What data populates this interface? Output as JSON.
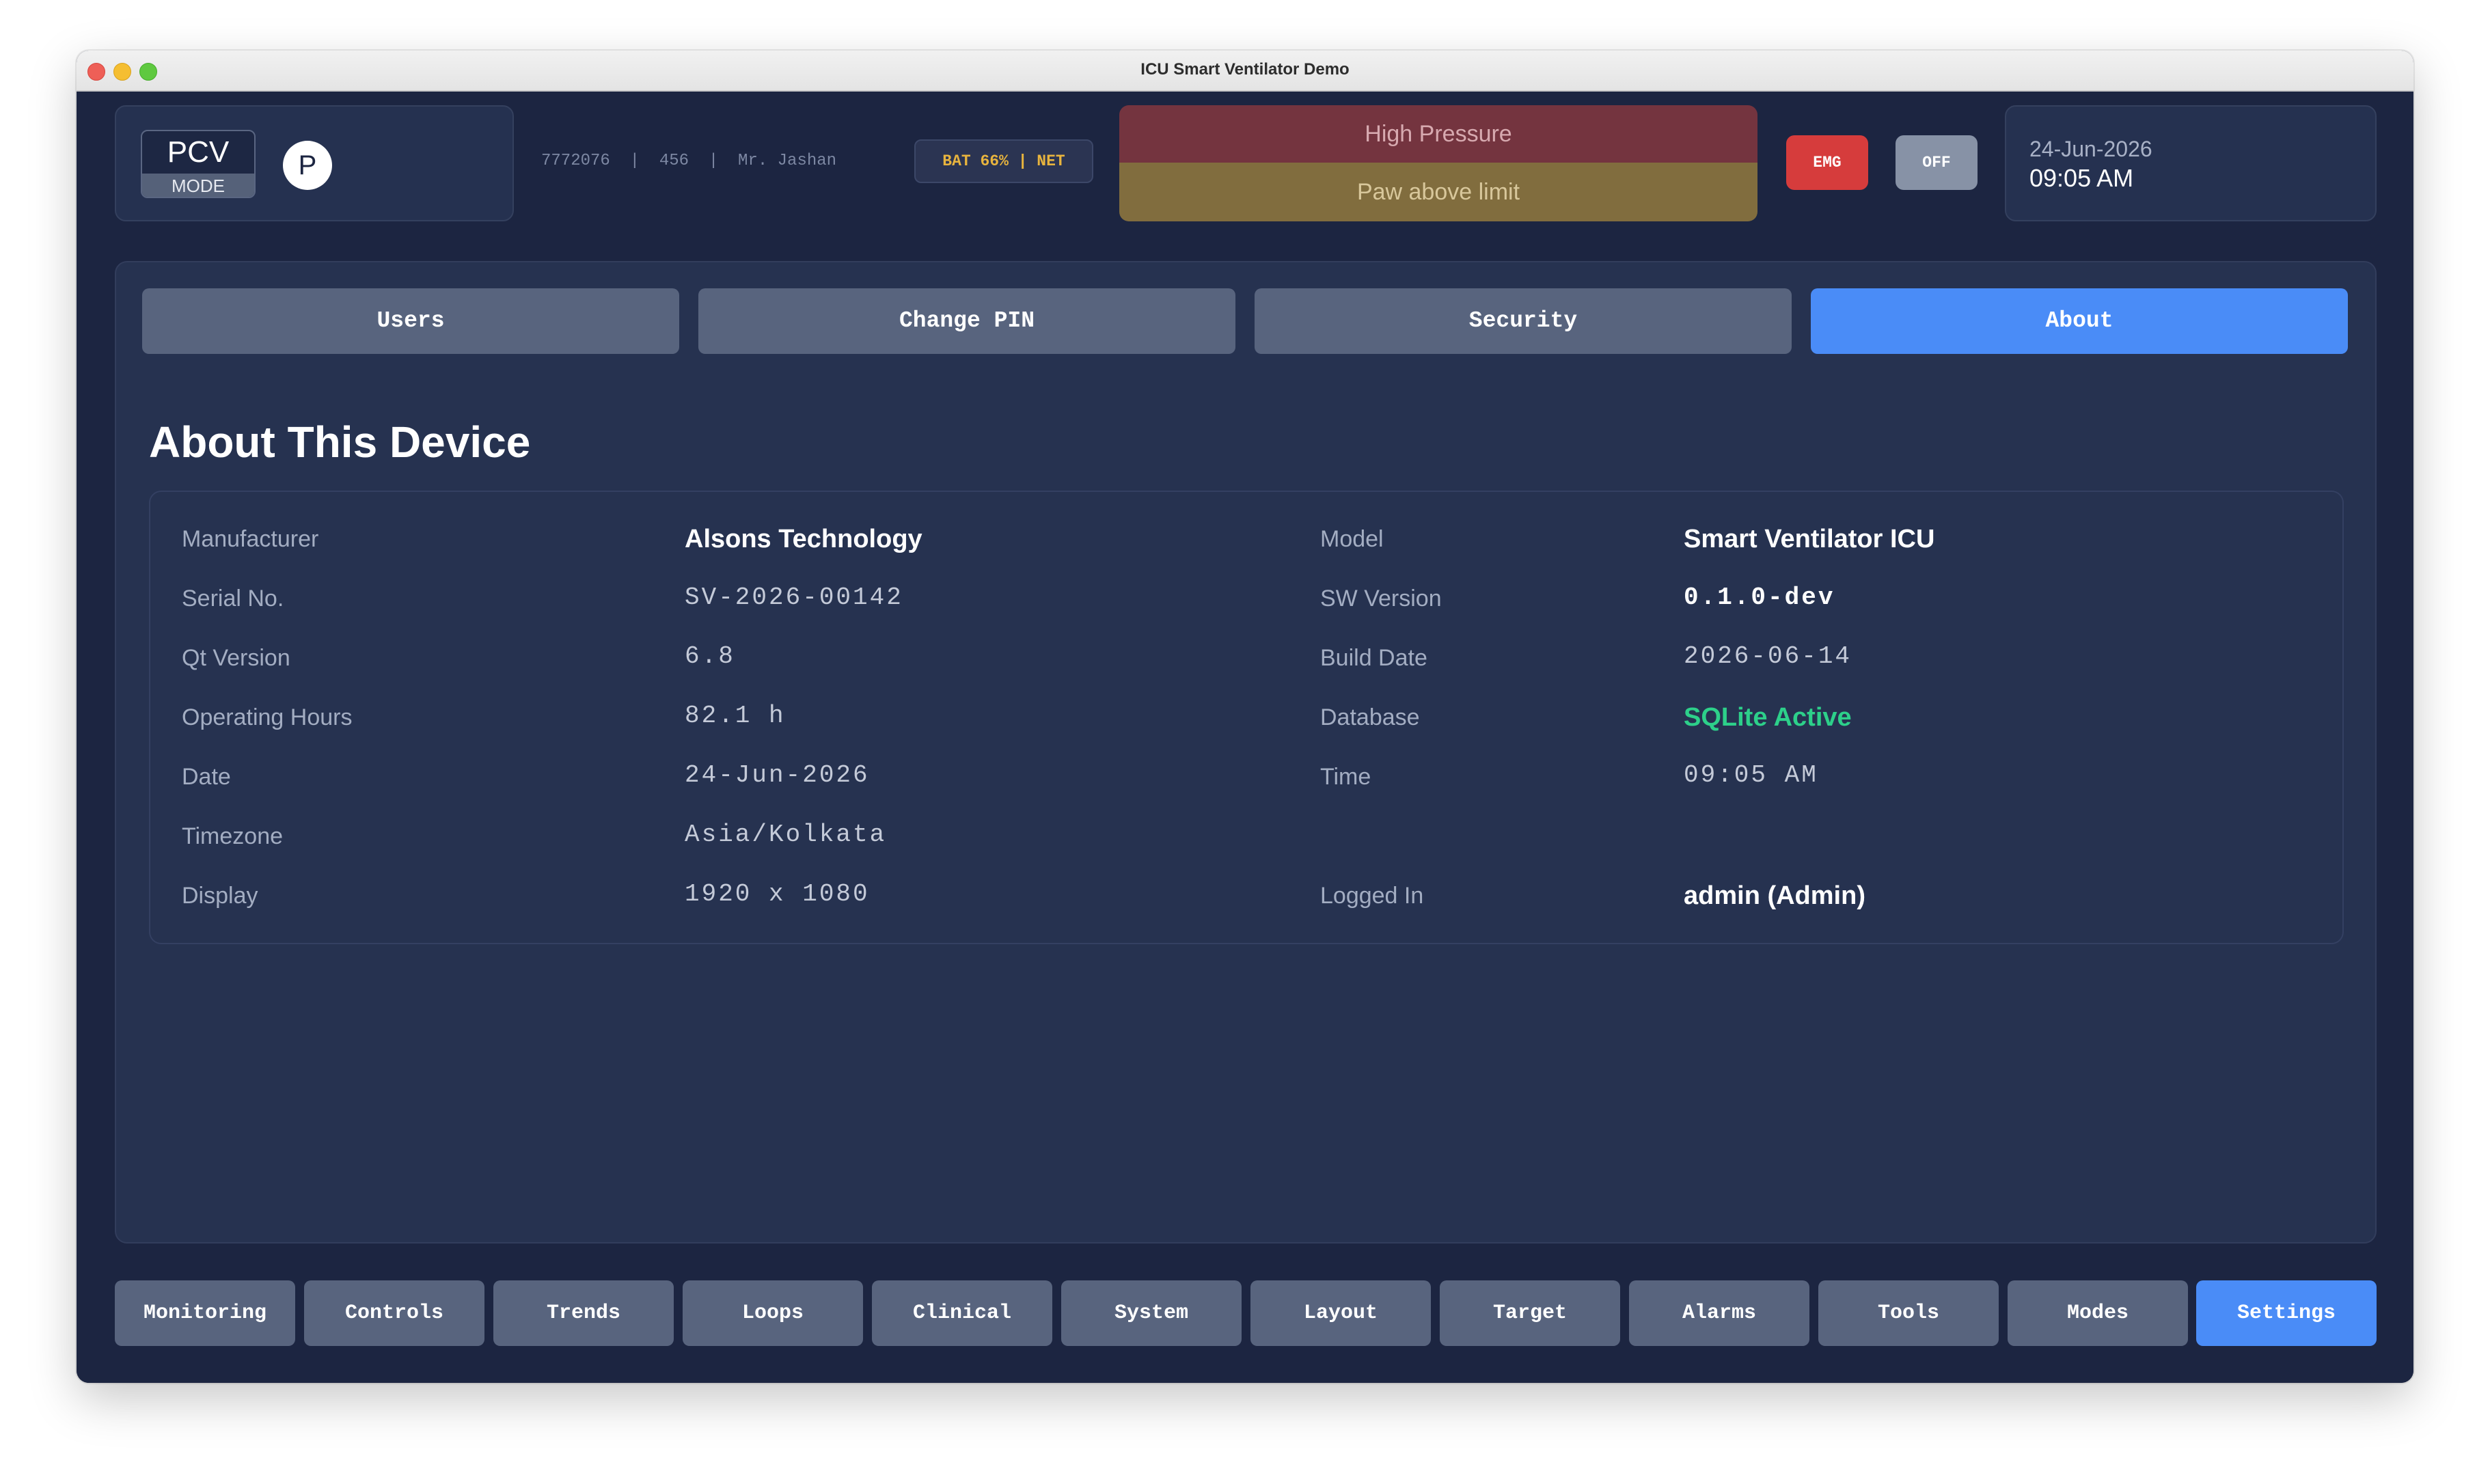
{
  "window": {
    "title": "ICU Smart Ventilator Demo"
  },
  "header": {
    "mode_name": "PCV",
    "mode_label": "MODE",
    "patient_type_letter": "P",
    "patient_info": "7772076  |  456  |  Mr. Jashan",
    "status_badge": "BAT 66% | NET",
    "alarm_primary": "High Pressure",
    "alarm_secondary": "Paw above limit",
    "emg_label": "EMG",
    "off_label": "OFF",
    "date": "24-Jun-2026",
    "time": "09:05 AM"
  },
  "settings": {
    "tabs": [
      {
        "label": "Users",
        "active": false
      },
      {
        "label": "Change PIN",
        "active": false
      },
      {
        "label": "Security",
        "active": false
      },
      {
        "label": "About",
        "active": true
      }
    ],
    "title": "About This Device",
    "info": {
      "manufacturer_label": "Manufacturer",
      "manufacturer_value": "Alsons Technology",
      "model_label": "Model",
      "model_value": "Smart Ventilator ICU",
      "serial_label": "Serial No.",
      "serial_value": "SV-2026-00142",
      "sw_version_label": "SW Version",
      "sw_version_value": "0.1.0-dev",
      "qt_version_label": "Qt Version",
      "qt_version_value": "6.8",
      "build_date_label": "Build Date",
      "build_date_value": "2026-06-14",
      "operating_hours_label": "Operating Hours",
      "operating_hours_value": "82.1 h",
      "database_label": "Database",
      "database_value": "SQLite Active",
      "date_label": "Date",
      "date_value": "24-Jun-2026",
      "time_label": "Time",
      "time_value": "09:05 AM",
      "timezone_label": "Timezone",
      "timezone_value": "Asia/Kolkata",
      "display_label": "Display",
      "display_value": "1920 x 1080",
      "logged_in_label": "Logged In",
      "logged_in_value": "admin (Admin)"
    }
  },
  "bottom_nav": [
    {
      "label": "Monitoring",
      "active": false
    },
    {
      "label": "Controls",
      "active": false
    },
    {
      "label": "Trends",
      "active": false
    },
    {
      "label": "Loops",
      "active": false
    },
    {
      "label": "Clinical",
      "active": false
    },
    {
      "label": "System",
      "active": false
    },
    {
      "label": "Layout",
      "active": false
    },
    {
      "label": "Target",
      "active": false
    },
    {
      "label": "Alarms",
      "active": false
    },
    {
      "label": "Tools",
      "active": false
    },
    {
      "label": "Modes",
      "active": false
    },
    {
      "label": "Settings",
      "active": true
    }
  ],
  "colors": {
    "background": "#1c2541",
    "panel": "#263250",
    "accent": "#4a8cf7",
    "button": "#58647e",
    "alarm_high": "#74343f",
    "alarm_warn": "#816d3e",
    "emergency": "#d63c3c",
    "status_ok": "#2dd08a",
    "battery_text": "#e8b43e"
  }
}
